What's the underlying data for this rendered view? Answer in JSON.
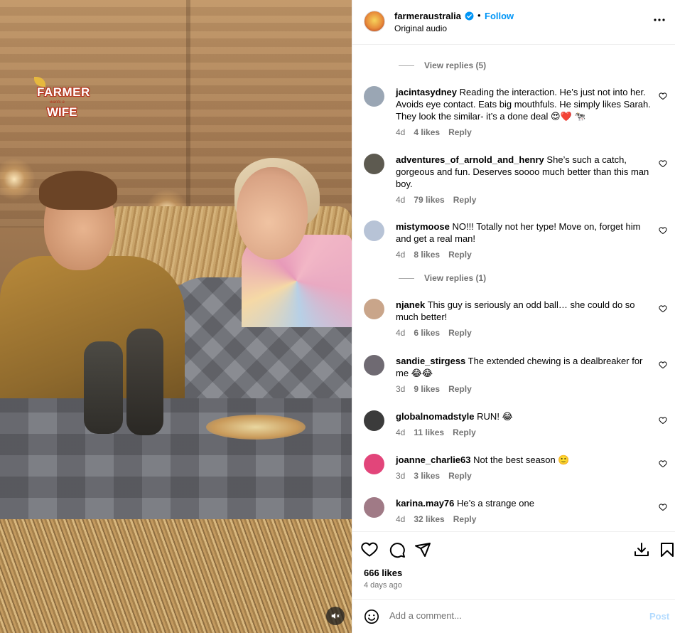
{
  "media": {
    "logo_text_top": "FARMER",
    "logo_text_mid": "wants a",
    "logo_text_bottom": "WIFE",
    "mute_icon": "speaker-muted-icon"
  },
  "header": {
    "username": "farmeraustralia",
    "follow_label": "Follow",
    "subtitle": "Original audio",
    "more_icon": "more-horizontal-icon",
    "separator": "•"
  },
  "comments": {
    "view_replies_1": "View replies (5)",
    "view_replies_2": "View replies (1)",
    "items": [
      {
        "username": "jacintasydney",
        "text": "Reading the interaction. He’s just not into her. Avoids eye contact. Eats big mouthfuls. He simply likes Sarah. They look the similar- it’s a done deal 😍❤️ 🐄",
        "age": "4d",
        "likes": "4 likes",
        "reply": "Reply",
        "avatar_color": "#9aa6b4"
      },
      {
        "username": "adventures_of_arnold_and_henry",
        "text": "She’s such a catch, gorgeous and fun. Deserves soooo much better than this man boy.",
        "age": "4d",
        "likes": "79 likes",
        "reply": "Reply",
        "avatar_color": "#5d5a50"
      },
      {
        "username": "mistymoose",
        "text": "NO!!! Totally not her type! Move on, forget him and get a real man!",
        "age": "4d",
        "likes": "8 likes",
        "reply": "Reply",
        "avatar_color": "#b7c3d6"
      },
      {
        "username": "njanek",
        "text": "This guy is seriously an odd ball… she could do so much better!",
        "age": "4d",
        "likes": "6 likes",
        "reply": "Reply",
        "avatar_color": "#c9a58a"
      },
      {
        "username": "sandie_stirgess",
        "text": "The extended chewing is a dealbreaker for me 😂😂",
        "age": "3d",
        "likes": "9 likes",
        "reply": "Reply",
        "avatar_color": "#6f6a72"
      },
      {
        "username": "globalnomadstyle",
        "text": "RUN! 😂",
        "age": "4d",
        "likes": "11 likes",
        "reply": "Reply",
        "avatar_color": "#3b3b3b"
      },
      {
        "username": "joanne_charlie63",
        "text": "Not the best season 🙂",
        "age": "3d",
        "likes": "3 likes",
        "reply": "Reply",
        "avatar_color": "#e2457a"
      },
      {
        "username": "karina.may76",
        "text": "He’s a strange one",
        "age": "4d",
        "likes": "32 likes",
        "reply": "Reply",
        "avatar_color": "#a07a86"
      }
    ]
  },
  "actions": {
    "like_icon": "heart-icon",
    "comment_icon": "comment-icon",
    "share_icon": "send-icon",
    "download_icon": "download-icon",
    "save_icon": "bookmark-icon",
    "likes_count": "666 likes",
    "posted_ago": "4 days ago"
  },
  "composer": {
    "placeholder": "Add a comment...",
    "post_label": "Post",
    "emoji_icon": "emoji-icon"
  },
  "colors": {
    "link_blue": "#0095f6",
    "muted_text": "#737373",
    "post_disabled": "#b3dbff"
  }
}
